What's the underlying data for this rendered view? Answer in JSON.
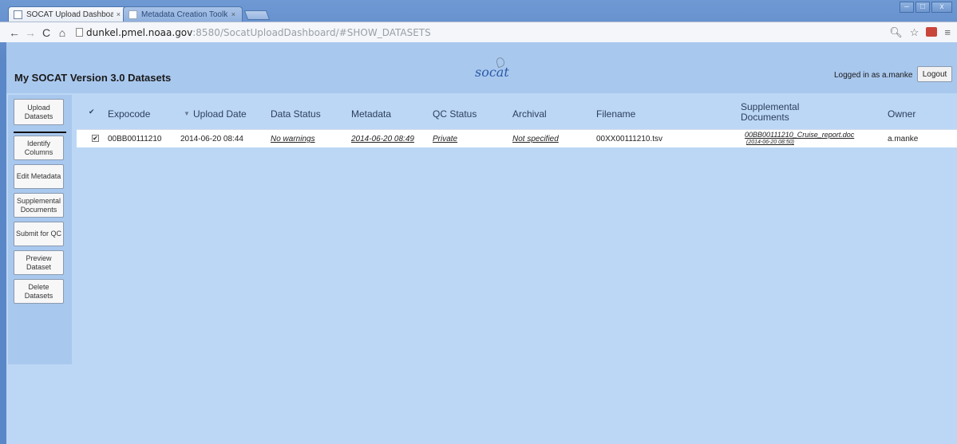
{
  "browser": {
    "tabs": [
      {
        "label": "SOCAT Upload Dashboar",
        "close": "×"
      },
      {
        "label": "Metadata Creation Toolk",
        "close": "×"
      }
    ],
    "url_host": "dunkel.pmel.noaa.gov",
    "url_rest": ":8580/SocatUploadDashboard/#SHOW_DATASETS",
    "window_controls": {
      "minimize": "–",
      "maximize": "□",
      "close": "x"
    }
  },
  "header": {
    "title": "My SOCAT Version 3.0 Datasets",
    "logo_text": "socat",
    "logged_in": "Logged in as a.manke",
    "logout_label": "Logout"
  },
  "sidebar": {
    "upload": "Upload Datasets",
    "identify": "Identify Columns",
    "edit": "Edit Metadata",
    "supplemental": "Supplemental Documents",
    "submit": "Submit for QC",
    "preview": "Preview Dataset",
    "delete": "Delete Datasets"
  },
  "table": {
    "columns": {
      "expocode": "Expocode",
      "upload_date": "Upload Date",
      "sort_indicator": "▼",
      "data_status": "Data Status",
      "metadata": "Metadata",
      "qc_status": "QC Status",
      "archival": "Archival",
      "filename": "Filename",
      "supplemental": "Supplemental Documents",
      "owner": "Owner"
    },
    "rows": [
      {
        "checked": "✔",
        "expocode": "00BB00111210",
        "upload_date": "2014-06-20 08:44",
        "data_status": "No warnings",
        "metadata": "2014-06-20 08:49",
        "qc_status": "Private",
        "archival": "Not specified",
        "filename": "00XX00111210.tsv",
        "supplemental_doc": "00BB00111210_Cruise_report.doc",
        "supplemental_date": "(2014-06-20 08:50)",
        "owner": "a.manke"
      }
    ]
  }
}
